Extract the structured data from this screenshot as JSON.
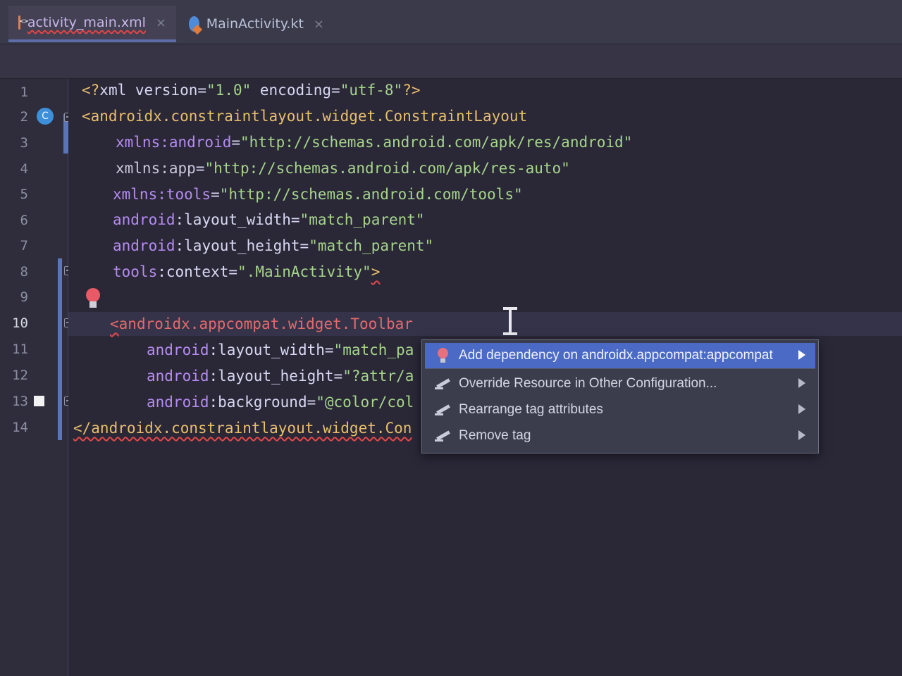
{
  "tabs": [
    {
      "label": "activity_main.xml",
      "icon": "xml-file-icon",
      "close": "×",
      "active": true
    },
    {
      "label": "MainActivity.kt",
      "icon": "kotlin-file-icon",
      "close": "×",
      "active": false
    }
  ],
  "gutter": {
    "line_numbers": [
      "1",
      "2",
      "3",
      "4",
      "5",
      "6",
      "7",
      "8",
      "9",
      "10",
      "11",
      "12",
      "13",
      "14"
    ],
    "current_line": "10",
    "class_marker": "C"
  },
  "code": {
    "line1": {
      "open": "<?",
      "name": "xml",
      "attr1": " version=",
      "val1": "\"1.0\"",
      "attr2": " encoding=",
      "val2": "\"utf-8\"",
      "close": "?>"
    },
    "line2": {
      "tag": "<androidx.constraintlayout.widget.ConstraintLayout"
    },
    "line3": {
      "ns": "xmlns:android",
      "eq": "=",
      "val": "\"http://schemas.android.com/apk/res/android\""
    },
    "line4": {
      "ns": "xmlns:app",
      "eq": "=",
      "val": "\"http://schemas.android.com/apk/res-auto\""
    },
    "line5": {
      "ns": "xmlns:tools",
      "eq": "=",
      "val": "\"http://schemas.android.com/tools\""
    },
    "line6": {
      "ns": "android",
      "attr": ":layout_width",
      "eq": "=",
      "val": "\"match_parent\""
    },
    "line7": {
      "ns": "android",
      "attr": ":layout_height",
      "eq": "=",
      "val": "\"match_parent\""
    },
    "line8": {
      "ns": "tools",
      "attr": ":context",
      "eq": "=",
      "val": "\".MainActivity\"",
      "close": ">"
    },
    "line10": {
      "lt": "<",
      "tag": "androidx.appcompat.widget.Toolbar"
    },
    "line11": {
      "ns": "android",
      "attr": ":layout_width",
      "eq": "=",
      "val": "\"match_pa"
    },
    "line12": {
      "ns": "android",
      "attr": ":layout_height",
      "eq": "=",
      "val": "\"?attr/a"
    },
    "line13": {
      "ns": "android",
      "attr": ":background",
      "eq": "=",
      "val": "\"@color/col"
    },
    "line14": {
      "tag": "</androidx.constraintlayout.widget.Con"
    }
  },
  "popup": {
    "items": [
      {
        "label": "Add dependency on androidx.appcompat:appcompat",
        "icon": "lightbulb-icon",
        "selected": true
      },
      {
        "label": "Override Resource in Other Configuration...",
        "icon": "pencil-icon",
        "selected": false
      },
      {
        "label": "Rearrange tag attributes",
        "icon": "pencil-icon",
        "selected": false
      },
      {
        "label": "Remove tag",
        "icon": "pencil-icon",
        "selected": false
      }
    ]
  },
  "colors": {
    "tag": "#e8bf6a",
    "error_tag": "#e26a6a",
    "namespace": "#b58cf0",
    "string": "#a5d58a",
    "selection": "#4a6ac6",
    "background": "#2a2737"
  }
}
